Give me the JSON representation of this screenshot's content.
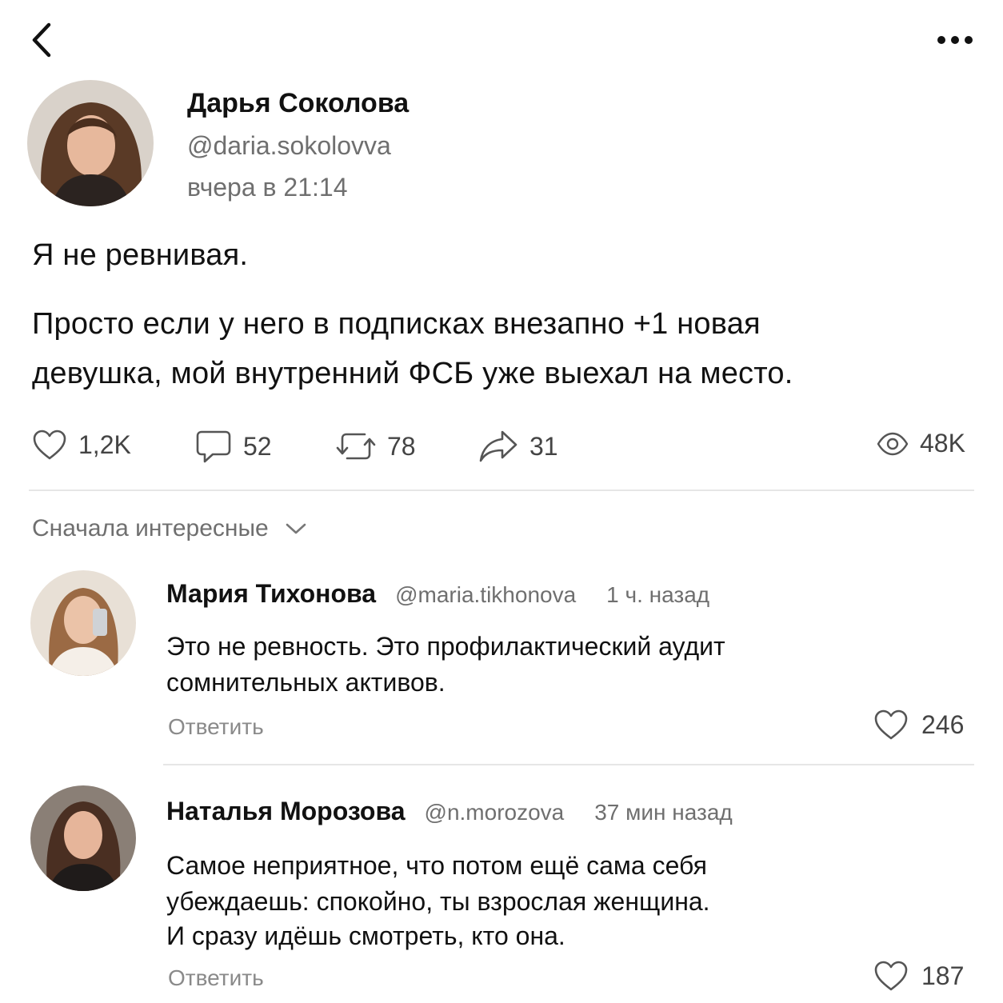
{
  "post": {
    "author_name": "Дарья Соколова",
    "author_handle": "@daria.sokolovva",
    "time": "вчера в 21:14",
    "text_line1": "Я не ревнивая.",
    "text_para2_line1": "Просто если у него в подписках внезапно +1 новая",
    "text_para2_line2": "девушка, мой внутренний ФСБ уже выехал на место.",
    "stats": {
      "likes": "1,2K",
      "comments": "52",
      "reposts": "78",
      "shares": "31",
      "views": "48K"
    }
  },
  "sort": {
    "label": "Сначала интересные"
  },
  "comments": [
    {
      "name": "Мария Тихонова",
      "handle": "@maria.tikhonova",
      "time": "1 ч. назад",
      "line1": "Это не ревность. Это профилактический аудит",
      "line2": "сомнительных активов.",
      "reply": "Ответить",
      "likes": "246"
    },
    {
      "name": "Наталья Морозова",
      "handle": "@n.morozova",
      "time": "37 мин назад",
      "line1": "Самое неприятное, что потом ещё сама себя",
      "line2": "убеждаешь: спокойно, ты взрослая женщина.",
      "line3": "И сразу идёшь смотреть, кто она.",
      "reply": "Ответить",
      "likes": "187"
    }
  ],
  "icons": [
    "back-icon",
    "more-icon",
    "heart-icon",
    "comment-icon",
    "repost-icon",
    "share-icon",
    "eye-icon",
    "chevron-down-icon"
  ]
}
